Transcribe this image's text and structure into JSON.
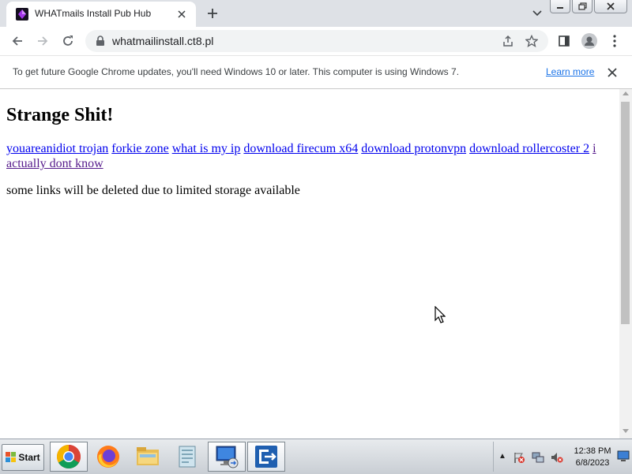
{
  "browser": {
    "tab": {
      "title": "WHATmails Install Pub Hub",
      "favicon": "purple-crystal-icon"
    },
    "new_tab_icon": "plus-icon",
    "url": "whatmailinstall.ct8.pl",
    "window_controls": [
      "minimize-icon",
      "restore-icon",
      "close-icon"
    ]
  },
  "infobar": {
    "message": "To get future Google Chrome updates, you'll need Windows 10 or later. This computer is using Windows 7.",
    "learn_more": "Learn more"
  },
  "page": {
    "heading": "Strange Shit!",
    "links": [
      {
        "label": "youareanidiot trojan",
        "visited": false
      },
      {
        "label": "forkie zone",
        "visited": false
      },
      {
        "label": "what is my ip",
        "visited": false
      },
      {
        "label": "download firecum x64",
        "visited": false
      },
      {
        "label": "download protonvpn",
        "visited": false
      },
      {
        "label": "download rollercoster 2",
        "visited": false
      },
      {
        "label": "i actually dont know",
        "visited": true
      }
    ],
    "notice": "some links will be deleted due to limited storage available"
  },
  "taskbar": {
    "start_label": "Start",
    "apps": [
      "chrome-icon",
      "firefox-icon",
      "file-explorer-icon",
      "notepad-icon",
      "remote-desktop-icon",
      "filezilla-icon"
    ],
    "clock_time": "12:38 PM",
    "clock_date": "6/8/2023"
  },
  "colors": {
    "link": "#0000ee",
    "link_visited": "#551a8b",
    "chrome_accent": "#1a73e8",
    "tabstrip": "#dee1e6"
  }
}
